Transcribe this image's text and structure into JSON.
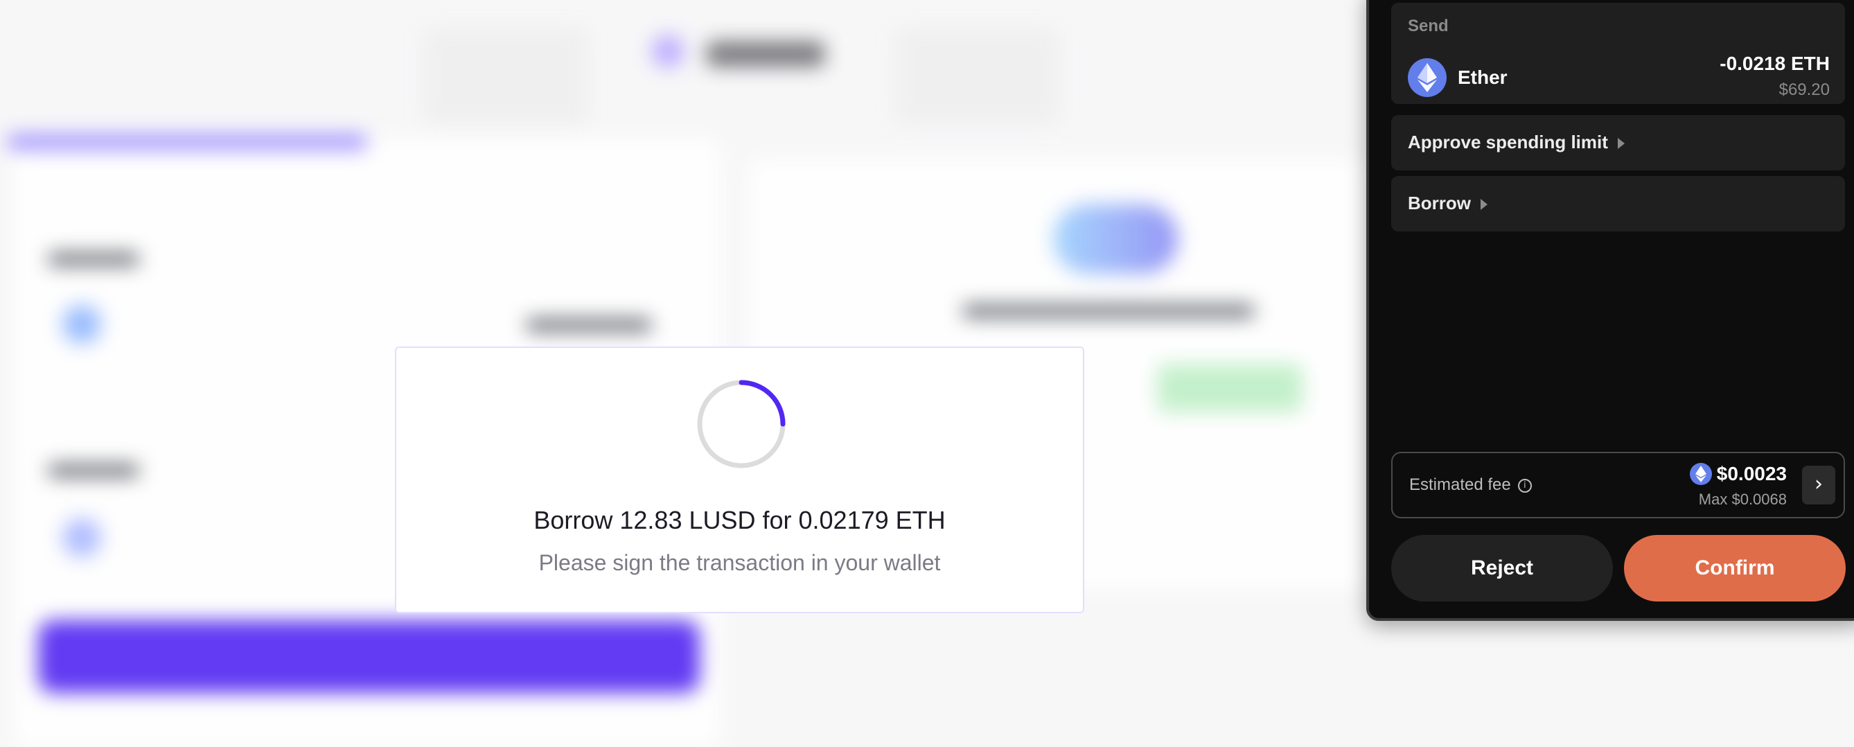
{
  "modal": {
    "title": "Borrow 12.83 LUSD for 0.02179 ETH",
    "subtitle": "Please sign the transaction in your wallet",
    "progress_fraction": 0.25,
    "spinner_color": "#5227f2"
  },
  "wallet": {
    "send": {
      "label": "Send",
      "asset_icon": "ethereum-icon",
      "asset_name": "Ether",
      "amount": "-0.0218 ETH",
      "amount_usd": "$69.20"
    },
    "steps": [
      {
        "label": "Approve spending limit"
      },
      {
        "label": "Borrow"
      }
    ],
    "fee": {
      "label": "Estimated fee",
      "value": "$0.0023",
      "max": "Max $0.0068"
    },
    "buttons": {
      "reject": "Reject",
      "confirm": "Confirm"
    },
    "colors": {
      "confirm": "#e06d4a",
      "background": "#0d0d0d",
      "eth": "#627eea"
    }
  }
}
